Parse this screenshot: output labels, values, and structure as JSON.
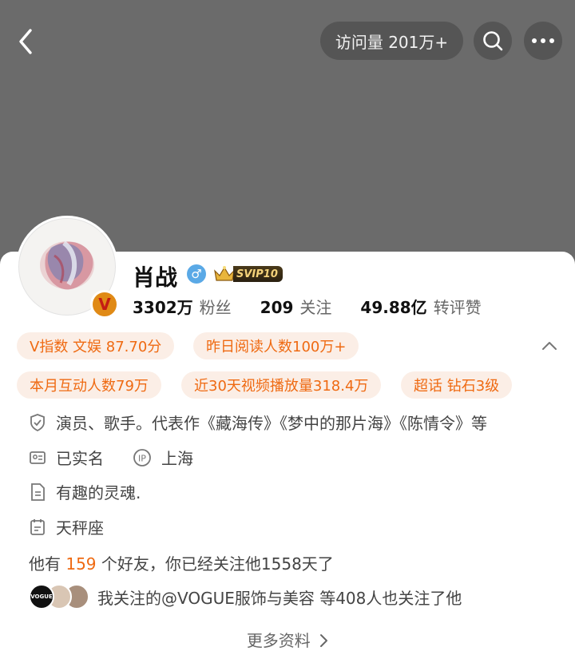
{
  "header": {
    "visits_label": "访问量 201万+"
  },
  "profile": {
    "name": "肖战",
    "gender_symbol": "♂",
    "vip_label": "SVIP10",
    "verified_symbol": "V",
    "stats": [
      {
        "value": "3302万",
        "label": "粉丝"
      },
      {
        "value": "209",
        "label": "关注"
      },
      {
        "value": "49.88亿",
        "label": "转评赞"
      }
    ]
  },
  "tags": [
    "V指数 文娱 87.70分",
    "昨日阅读人数100万+",
    "本月互动人数79万",
    "近30天视频播放量318.4万",
    "超话 钻石3级"
  ],
  "info": {
    "verification": "演员、歌手。代表作《藏海传》《梦中的那片海》《陈情令》等",
    "realname": "已实名",
    "ip_location": "上海",
    "bio": "有趣的灵魂.",
    "zodiac": "天秤座"
  },
  "friends": {
    "prefix": "他有 ",
    "count": "159",
    "suffix": " 个好友，你已经关注他1558天了"
  },
  "mutual": {
    "vogue_avatar_text": "VOGUE",
    "text": "我关注的@VOGUE服饰与美容 等408人也关注了他"
  },
  "more_info_label": "更多资料",
  "colors": {
    "accent": "#ef6a12",
    "tag_bg": "#fbeee6",
    "banner": "#6b6b6b",
    "gender_blue": "#5aa9e6"
  }
}
